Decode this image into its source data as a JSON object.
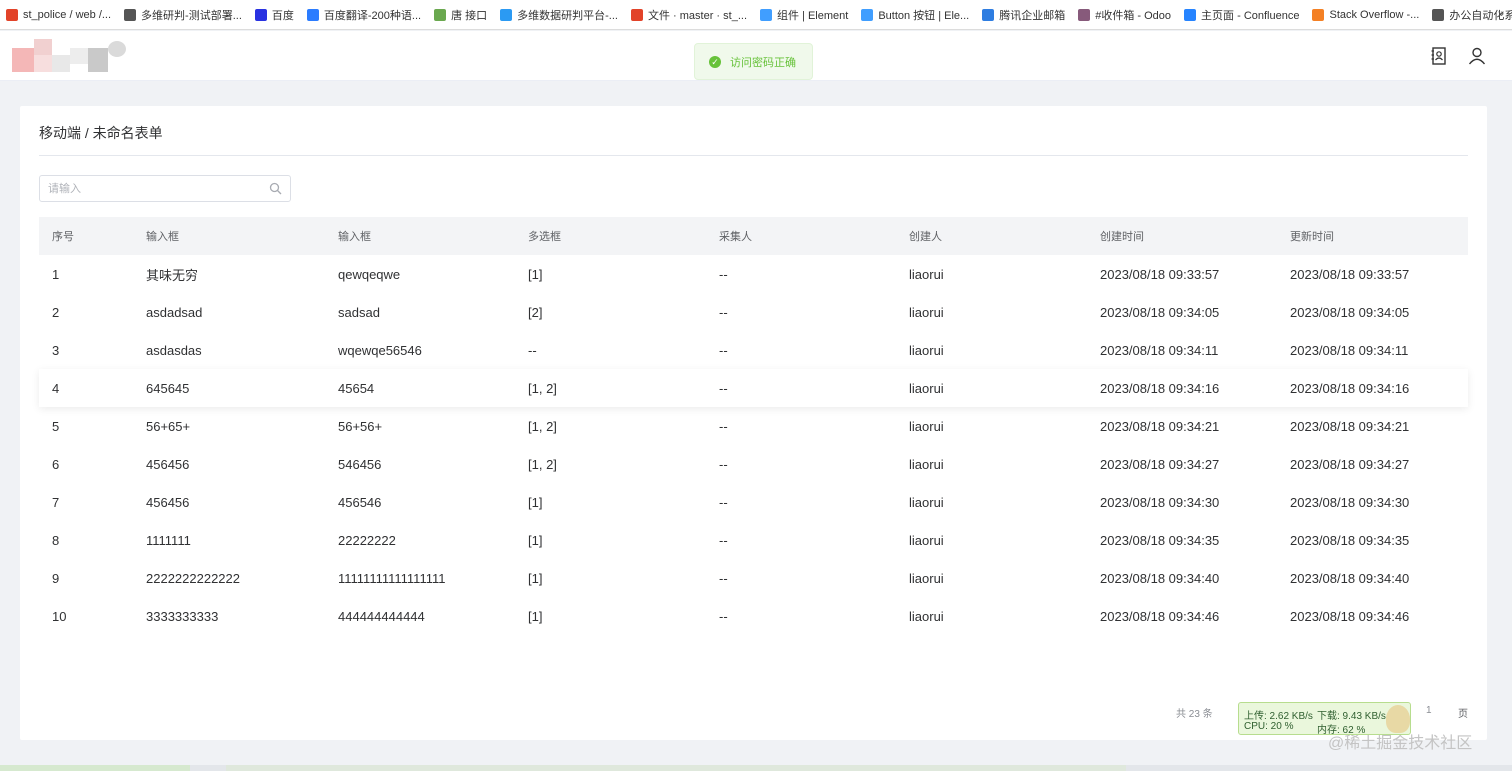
{
  "bookmarks": [
    {
      "label": "st_police / web /...",
      "icon": "gitlab-icon",
      "color": "#e24329"
    },
    {
      "label": "多维研判-测试部署...",
      "icon": "globe-icon",
      "color": "#555555"
    },
    {
      "label": "百度",
      "icon": "baidu-icon",
      "color": "#2932e1"
    },
    {
      "label": "百度翻译-200种语...",
      "icon": "translate-icon",
      "color": "#2b7cff"
    },
    {
      "label": "唐 接口",
      "icon": "api-icon",
      "color": "#6aa84f"
    },
    {
      "label": "多维数据研判平台-...",
      "icon": "platform-icon",
      "color": "#2b9af3"
    },
    {
      "label": "文件 · master · st_...",
      "icon": "gitlab-icon",
      "color": "#e24329"
    },
    {
      "label": "组件 | Element",
      "icon": "element-icon",
      "color": "#409eff"
    },
    {
      "label": "Button 按钮 | Ele...",
      "icon": "element-icon",
      "color": "#409eff"
    },
    {
      "label": "腾讯企业邮箱",
      "icon": "mail-icon",
      "color": "#2e7de1"
    },
    {
      "label": "#收件箱 - Odoo",
      "icon": "odoo-icon",
      "color": "#875a7b"
    },
    {
      "label": "主页面 - Confluence",
      "icon": "confluence-icon",
      "color": "#2684ff"
    },
    {
      "label": "Stack Overflow -...",
      "icon": "stackoverflow-icon",
      "color": "#f48024"
    },
    {
      "label": "办公自动化系统",
      "icon": "globe-icon",
      "color": "#555555"
    }
  ],
  "bookmarks_more": "»",
  "toast": {
    "message": "访问密码正确",
    "color": "#67c23a"
  },
  "breadcrumb": "移动端 / 未命名表单",
  "search": {
    "placeholder": "请输入"
  },
  "table": {
    "headers": [
      "序号",
      "输入框",
      "输入框",
      "多选框",
      "采集人",
      "创建人",
      "创建时间",
      "更新时间"
    ],
    "rows": [
      [
        "1",
        "其味无穷",
        "qewqeqwe",
        "[1]",
        "--",
        "liaorui",
        "2023/08/18 09:33:57",
        "2023/08/18 09:33:57"
      ],
      [
        "2",
        "asdadsad",
        "sadsad",
        "[2]",
        "--",
        "liaorui",
        "2023/08/18 09:34:05",
        "2023/08/18 09:34:05"
      ],
      [
        "3",
        "asdasdas",
        "wqewqe56546",
        "--",
        "--",
        "liaorui",
        "2023/08/18 09:34:11",
        "2023/08/18 09:34:11"
      ],
      [
        "4",
        "645645",
        "45654",
        "[1, 2]",
        "--",
        "liaorui",
        "2023/08/18 09:34:16",
        "2023/08/18 09:34:16"
      ],
      [
        "5",
        "56+65+",
        "56+56+",
        "[1, 2]",
        "--",
        "liaorui",
        "2023/08/18 09:34:21",
        "2023/08/18 09:34:21"
      ],
      [
        "6",
        "456456",
        "546456",
        "[1, 2]",
        "--",
        "liaorui",
        "2023/08/18 09:34:27",
        "2023/08/18 09:34:27"
      ],
      [
        "7",
        "456456",
        "456546",
        "[1]",
        "--",
        "liaorui",
        "2023/08/18 09:34:30",
        "2023/08/18 09:34:30"
      ],
      [
        "8",
        "1111111",
        "22222222",
        "[1]",
        "--",
        "liaorui",
        "2023/08/18 09:34:35",
        "2023/08/18 09:34:35"
      ],
      [
        "9",
        "2222222222222",
        "11111111111111111",
        "[1]",
        "--",
        "liaorui",
        "2023/08/18 09:34:40",
        "2023/08/18 09:34:40"
      ],
      [
        "10",
        "3333333333",
        "444444444444",
        "[1]",
        "--",
        "liaorui",
        "2023/08/18 09:34:46",
        "2023/08/18 09:34:46"
      ]
    ],
    "highlighted_row": 4
  },
  "pagination": {
    "total": "共 23 条",
    "current": "1",
    "unit": "页"
  },
  "net_monitor": {
    "upload": "上传: 2.62 KB/s",
    "download": "下载: 9.43 KB/s",
    "cpu": "CPU: 20 %",
    "memory": "内存: 62 %"
  },
  "watermark": "@稀土掘金技术社区"
}
